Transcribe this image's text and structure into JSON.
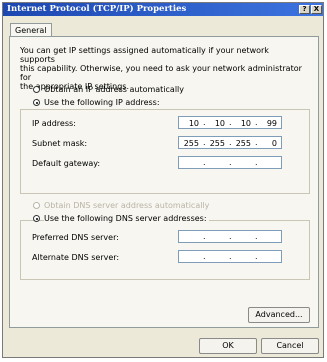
{
  "window": {
    "title": "Internet Protocol (TCP/IP) Properties",
    "help_label": "?",
    "close_label": "X"
  },
  "tabs": [
    {
      "label": "General"
    }
  ],
  "description": [
    "You can get IP settings assigned automatically if your network supports",
    "this capability. Otherwise, you need to ask your network administrator for",
    "the appropriate IP settings."
  ],
  "ip_mode": {
    "auto_label": "Obtain an IP address automatically",
    "manual_label": "Use the following IP address:",
    "selected": "manual"
  },
  "ip_address": {
    "label": "IP address:",
    "octets": [
      "10",
      "10",
      "10",
      "99"
    ]
  },
  "subnet_mask": {
    "label": "Subnet mask:",
    "octets": [
      "255",
      "255",
      "255",
      "0"
    ]
  },
  "default_gateway": {
    "label": "Default gateway:",
    "octets": [
      "",
      "",
      "",
      ""
    ]
  },
  "dns_mode": {
    "auto_label": "Obtain DNS server address automatically",
    "manual_label": "Use the following DNS server addresses:",
    "selected": "manual"
  },
  "preferred_dns": {
    "label": "Preferred DNS server:",
    "octets": [
      "",
      "",
      "",
      ""
    ]
  },
  "alternate_dns": {
    "label": "Alternate DNS server:",
    "octets": [
      "",
      "",
      "",
      ""
    ]
  },
  "buttons": {
    "advanced": "Advanced...",
    "ok": "OK",
    "cancel": "Cancel"
  }
}
